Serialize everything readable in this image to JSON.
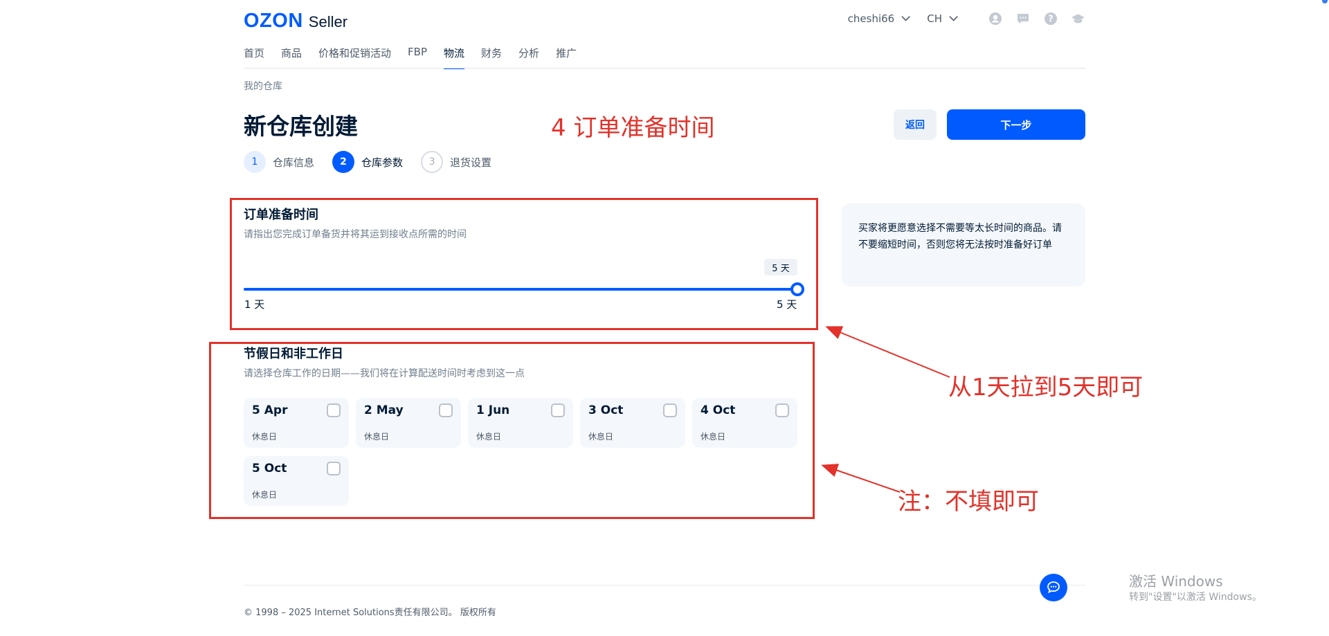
{
  "header": {
    "logo_brand": "OZON",
    "logo_product": "Seller",
    "account": "cheshi66",
    "language": "CH",
    "icons": [
      "user-icon",
      "chat-icon",
      "help-icon",
      "education-icon"
    ]
  },
  "nav": {
    "items": [
      {
        "label": "首页"
      },
      {
        "label": "商品"
      },
      {
        "label": "价格和促销活动"
      },
      {
        "label": "FBP"
      },
      {
        "label": "物流",
        "active": true
      },
      {
        "label": "财务"
      },
      {
        "label": "分析"
      },
      {
        "label": "推广"
      }
    ]
  },
  "breadcrumb": "我的仓库",
  "page_title": "新仓库创建",
  "buttons": {
    "back": "返回",
    "next": "下一步"
  },
  "steps": [
    {
      "num": "1",
      "label": "仓库信息",
      "state": "done"
    },
    {
      "num": "2",
      "label": "仓库参数",
      "state": "current"
    },
    {
      "num": "3",
      "label": "退货设置",
      "state": "todo"
    }
  ],
  "prep_time": {
    "title": "订单准备时间",
    "desc": "请指出您完成订单备货并将其运到接收点所需的时间",
    "value_label": "5 天",
    "value": 5,
    "min": 1,
    "max": 5,
    "min_label": "1 天",
    "max_label": "5 天"
  },
  "tip": "买家将更愿意选择不需要等太长时间的商品。请不要缩短时间，否则您将无法按时准备好订单",
  "holidays": {
    "title": "节假日和非工作日",
    "desc": "请选择仓库工作的日期——我们将在计算配送时间时考虑到这一点",
    "items": [
      {
        "date": "5 Apr",
        "sub": "休息日",
        "checked": false
      },
      {
        "date": "2 May",
        "sub": "休息日",
        "checked": false
      },
      {
        "date": "1 Jun",
        "sub": "休息日",
        "checked": false
      },
      {
        "date": "3 Oct",
        "sub": "休息日",
        "checked": false
      },
      {
        "date": "4 Oct",
        "sub": "休息日",
        "checked": false
      },
      {
        "date": "5 Oct",
        "sub": "休息日",
        "checked": false
      }
    ]
  },
  "annotations": {
    "heading": "4 订单准备时间",
    "slider_note": "从1天拉到5天即可",
    "holiday_note": "注：不填即可",
    "color": "#e2322a"
  },
  "footer": "© 1998 – 2025 Internet Solutions责任有限公司。 版权所有",
  "watermark": {
    "line1": "激活 Windows",
    "line2": "转到\"设置\"以激活 Windows。"
  },
  "colors": {
    "accent": "#005bff",
    "text": "#001a34",
    "muted": "#707f8d"
  }
}
